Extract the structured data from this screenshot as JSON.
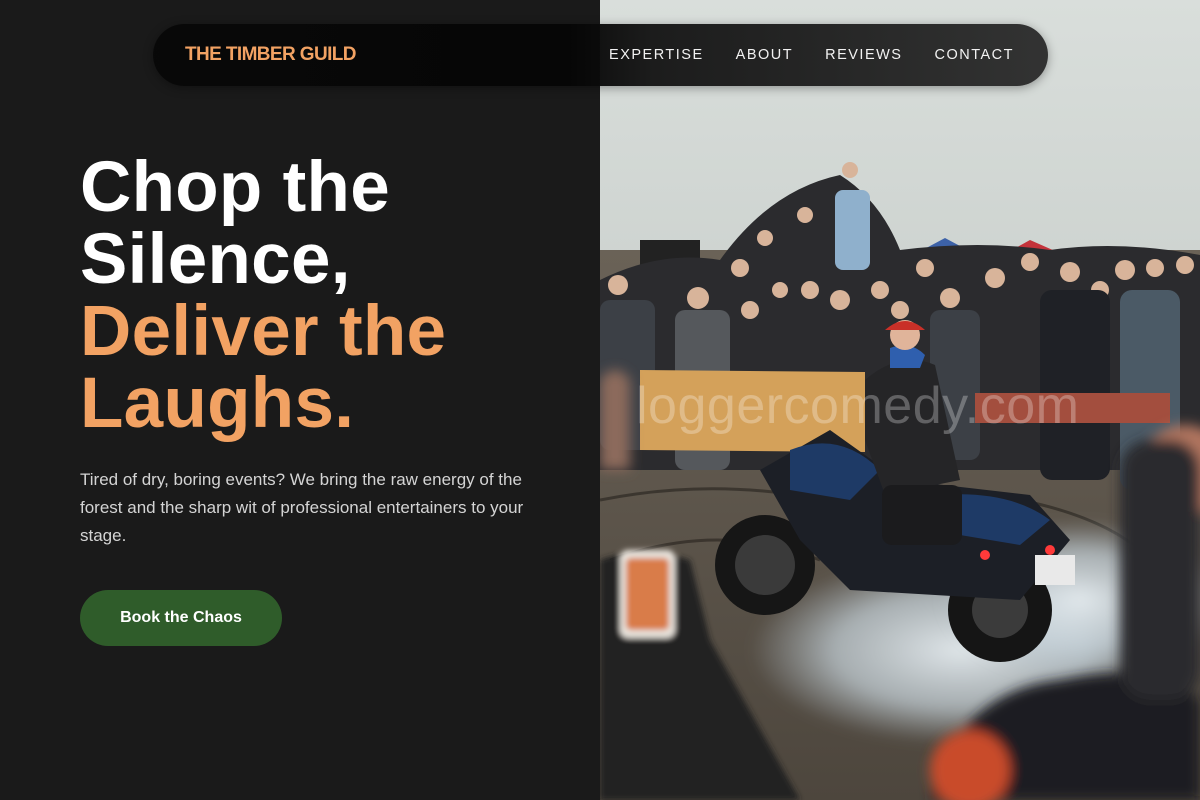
{
  "brand": {
    "name": "THE TIMBER GUILD"
  },
  "nav": {
    "links": [
      {
        "label": "EXPERTISE"
      },
      {
        "label": "ABOUT"
      },
      {
        "label": "REVIEWS"
      },
      {
        "label": "CONTACT"
      }
    ]
  },
  "hero": {
    "title_lines": [
      "Chop the",
      "Silence,"
    ],
    "accent_lines": [
      "Deliver the",
      "Laughs."
    ],
    "subtitle": "Tired of dry, boring events? We bring the raw energy of the forest and the sharp wit of professional entertainers to your stage.",
    "cta_label": "Book the Chaos"
  },
  "photo": {
    "watermark": "loggercomedy.com",
    "subject": "motorcycle-burnout-crowd-photo"
  },
  "colors": {
    "background": "#1a1a1a",
    "accent": "#f2a263",
    "cta": "#2f5c2a",
    "text": "#ffffff",
    "muted_text": "#d4d4d4"
  }
}
